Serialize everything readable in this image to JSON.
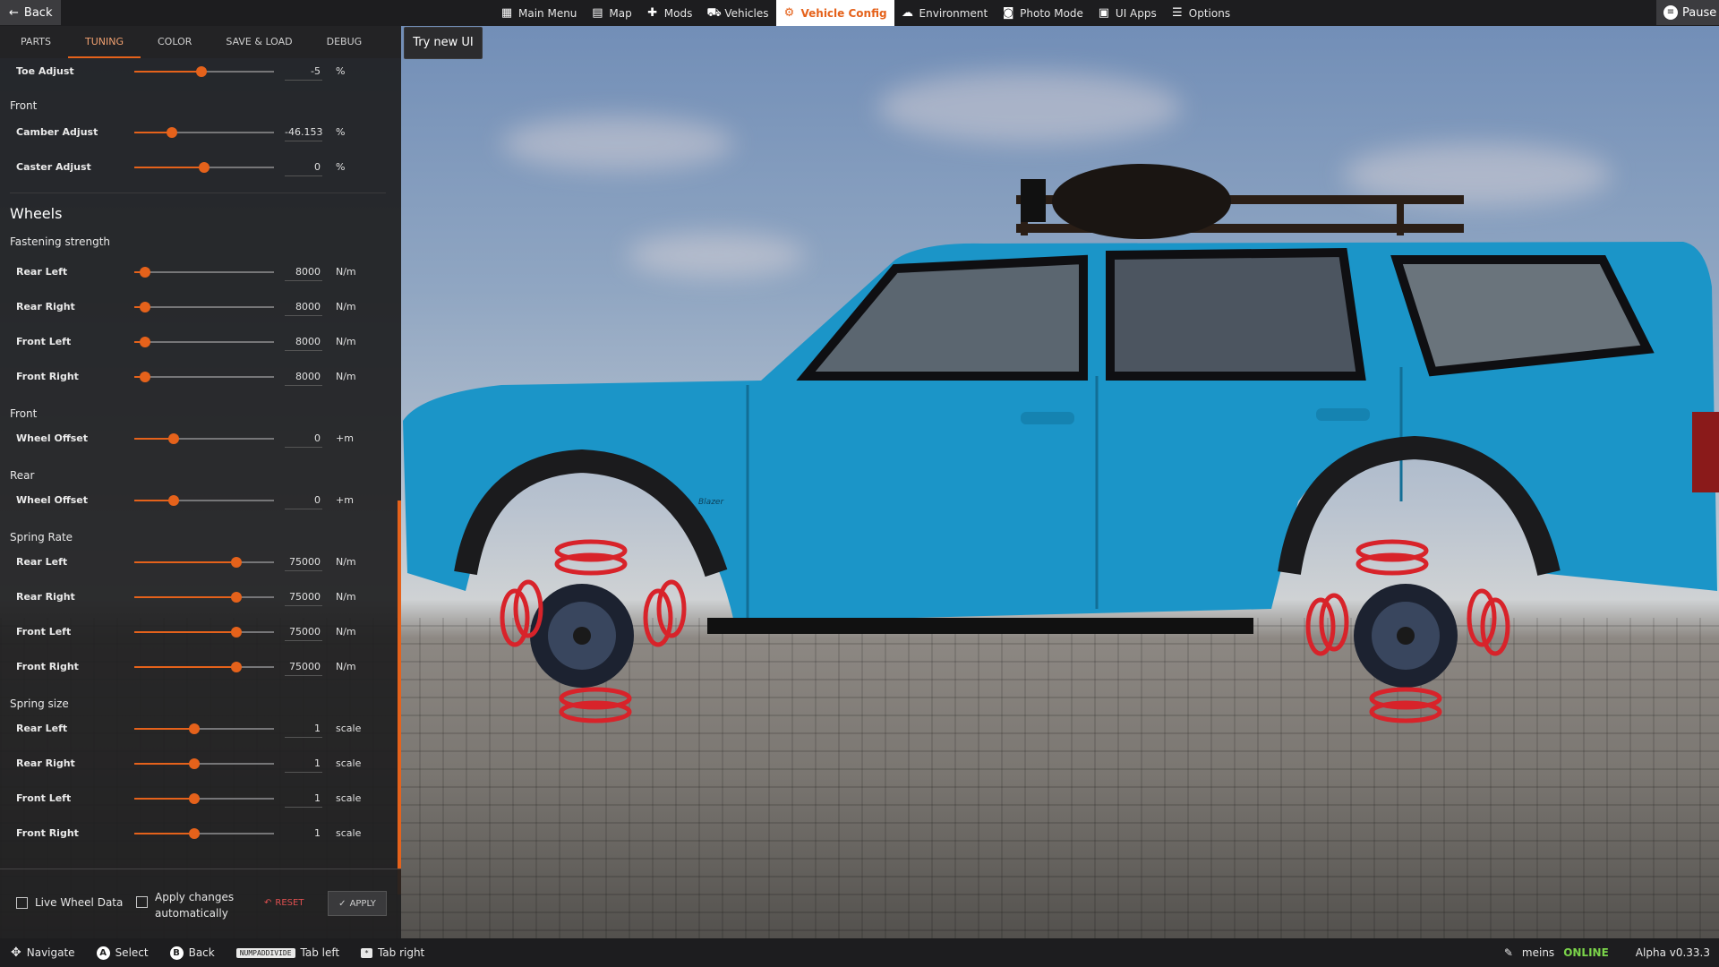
{
  "topbar": {
    "back_label": "Back",
    "nav": [
      {
        "label": "Main Menu",
        "icon": "main-menu-icon"
      },
      {
        "label": "Map",
        "icon": "map-icon"
      },
      {
        "label": "Mods",
        "icon": "mods-icon"
      },
      {
        "label": "Vehicles",
        "icon": "vehicles-icon"
      },
      {
        "label": "Vehicle Config",
        "icon": "vehicle-config-icon",
        "active": true
      },
      {
        "label": "Environment",
        "icon": "environment-icon"
      },
      {
        "label": "Photo Mode",
        "icon": "photo-mode-icon"
      },
      {
        "label": "UI Apps",
        "icon": "ui-apps-icon"
      },
      {
        "label": "Options",
        "icon": "options-icon"
      }
    ],
    "pause_label": "Pause"
  },
  "panel": {
    "tabs": [
      "PARTS",
      "TUNING",
      "COLOR",
      "SAVE & LOAD",
      "DEBUG"
    ],
    "active_tab": "TUNING",
    "try_new_ui": "Try new UI",
    "toe": {
      "label": "Toe Adjust",
      "value": "-5",
      "unit": "%",
      "level": 0.48
    },
    "front_heading": "Front",
    "camber": {
      "label": "Camber Adjust",
      "value": "-46.153",
      "unit": "%",
      "level": 0.27
    },
    "caster": {
      "label": "Caster Adjust",
      "value": "0",
      "unit": "%",
      "level": 0.5
    },
    "wheels_title": "Wheels",
    "fastening_title": "Fastening strength",
    "fastening": [
      {
        "label": "Rear Left",
        "value": "8000",
        "unit": "N/m",
        "level": 0.08
      },
      {
        "label": "Rear Right",
        "value": "8000",
        "unit": "N/m",
        "level": 0.08
      },
      {
        "label": "Front Left",
        "value": "8000",
        "unit": "N/m",
        "level": 0.08
      },
      {
        "label": "Front Right",
        "value": "8000",
        "unit": "N/m",
        "level": 0.08
      }
    ],
    "front_offset_heading": "Front",
    "front_offset": {
      "label": "Wheel Offset",
      "value": "0",
      "unit": "+m",
      "level": 0.28
    },
    "rear_offset_heading": "Rear",
    "rear_offset": {
      "label": "Wheel Offset",
      "value": "0",
      "unit": "+m",
      "level": 0.28
    },
    "spring_rate_title": "Spring Rate",
    "spring_rate": [
      {
        "label": "Rear Left",
        "value": "75000",
        "unit": "N/m",
        "level": 0.73
      },
      {
        "label": "Rear Right",
        "value": "75000",
        "unit": "N/m",
        "level": 0.73
      },
      {
        "label": "Front Left",
        "value": "75000",
        "unit": "N/m",
        "level": 0.73
      },
      {
        "label": "Front Right",
        "value": "75000",
        "unit": "N/m",
        "level": 0.73
      }
    ],
    "spring_size_title": "Spring size",
    "spring_size": [
      {
        "label": "Rear Left",
        "value": "1",
        "unit": "scale",
        "level": 0.43
      },
      {
        "label": "Rear Right",
        "value": "1",
        "unit": "scale",
        "level": 0.43
      },
      {
        "label": "Front Left",
        "value": "1",
        "unit": "scale",
        "level": 0.43
      },
      {
        "label": "Front Right",
        "value": "1",
        "unit": "scale",
        "level": 0.43
      }
    ],
    "footer": {
      "live_wheel_data": "Live Wheel Data",
      "apply_auto_line1": "Apply changes",
      "apply_auto_line2": "automatically",
      "reset": "RESET",
      "apply": "APPLY"
    }
  },
  "vehicle": {
    "badge_text": "Blazer"
  },
  "bottombar": {
    "hints": [
      {
        "label": "Navigate",
        "icon": "dpad-icon"
      },
      {
        "label": "Select",
        "key": "A"
      },
      {
        "label": "Back",
        "key": "B"
      },
      {
        "label": "Tab left",
        "key": "NUMPADDIVIDE"
      },
      {
        "label": "Tab right",
        "key": "*"
      }
    ],
    "user": "meins",
    "status": "ONLINE",
    "version": "Alpha v0.33.3"
  },
  "colors": {
    "accent": "#e5621b",
    "vehicle": "#1b95c8",
    "springs": "#d8232a"
  }
}
